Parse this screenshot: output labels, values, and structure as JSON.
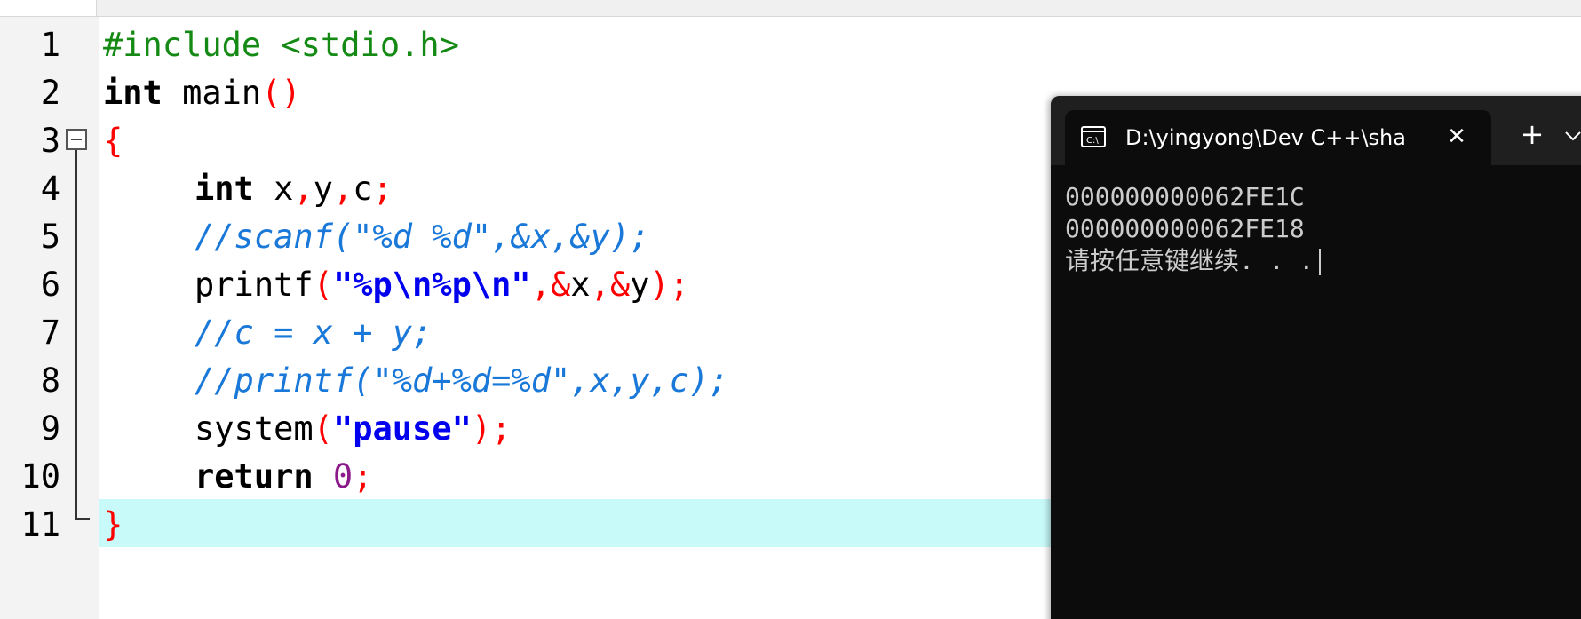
{
  "editor": {
    "line_numbers": [
      "1",
      "2",
      "3",
      "4",
      "5",
      "6",
      "7",
      "8",
      "9",
      "10",
      "11"
    ],
    "code": {
      "l1_pre": "#include <stdio.h>",
      "l2_kw": "int",
      "l2_id": " main",
      "l2_sym": "()",
      "l3_sym": "{",
      "l4_kw": "int",
      "l4_a": " x",
      "l4_b": ",",
      "l4_c": "y",
      "l4_d": ",",
      "l4_e": "c",
      "l4_f": ";",
      "l5_cmt": "//scanf(\"%d %d\",&x,&y);",
      "l6_id": "printf",
      "l6_a": "(",
      "l6_str": "\"%p\\n%p\\n\"",
      "l6_b": ",&",
      "l6_c": "x",
      "l6_d": ",&",
      "l6_e": "y",
      "l6_f": ");",
      "l7_cmt": "//c = x + y;",
      "l8_cmt": "//printf(\"%d+%d=%d\",x,y,c);",
      "l9_id": "system",
      "l9_a": "(",
      "l9_str": "\"pause\"",
      "l9_b": ");",
      "l10_kw": "return",
      "l10_num": " 0",
      "l10_sym": ";",
      "l11_sym": "}"
    },
    "colors": {
      "preprocessor": "#148a14",
      "symbol": "#ff0000",
      "string": "#0000ee",
      "comment": "#1a78d8",
      "number": "#8b1a8b",
      "current_line": "#c8fafa"
    }
  },
  "terminal": {
    "icon": "console-icon",
    "tab_title": "D:\\yingyong\\Dev C++\\sha",
    "close_icon": "close-icon",
    "close_glyph": "✕",
    "new_tab_glyph": "+",
    "dropdown_icon": "chevron-down-icon",
    "output": [
      "000000000062FE1C",
      "000000000062FE18",
      "请按任意键继续. . ."
    ]
  }
}
